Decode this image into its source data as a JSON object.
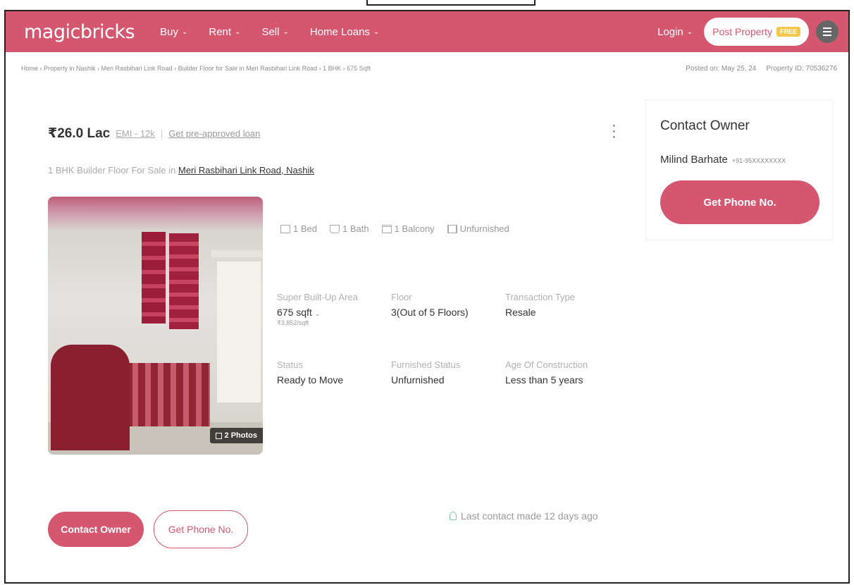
{
  "header": {
    "logo": "magicbricks",
    "nav": [
      {
        "label": "Buy"
      },
      {
        "label": "Rent"
      },
      {
        "label": "Sell"
      },
      {
        "label": "Home Loans"
      }
    ],
    "login": "Login",
    "post_property": "Post Property",
    "free_badge": "FREE",
    "brand_color": "#d4576f"
  },
  "breadcrumb": {
    "path": "Home › Property in Nashik › Meri Rasbihari Link Road › Builder Floor for Sale in Meri Rasbihari Link Road › 1 BHK › 675 Sqft",
    "posted_on": "Posted on: May 25, 24",
    "property_id": "Property ID: 70536276"
  },
  "listing": {
    "price": "26.0 Lac",
    "emi": "EMI - 12k",
    "pre_approved_loan": "Get pre-approved loan",
    "title_prefix": "1 BHK Builder Floor For Sale in",
    "location": "Meri Rasbihari Link Road, Nashik",
    "photos_count": "2 Photos",
    "features": {
      "bed": "1 Bed",
      "bath": "1 Bath",
      "balcony": "1 Balcony",
      "furnishing": "Unfurnished"
    },
    "details": [
      {
        "label": "Super Built-Up Area",
        "value": "675 sqft",
        "sub": "3,852/sqft"
      },
      {
        "label": "Floor",
        "value": "3(Out of 5 Floors)"
      },
      {
        "label": "Transaction Type",
        "value": "Resale"
      },
      {
        "label": "Status",
        "value": "Ready to Move"
      },
      {
        "label": "Furnished Status",
        "value": "Unfurnished"
      },
      {
        "label": "Age Of Construction",
        "value": "Less than 5 years"
      }
    ],
    "contact_owner_btn": "Contact Owner",
    "get_phone_btn": "Get Phone No.",
    "last_contact": "Last contact made 12 days ago"
  },
  "sidebar": {
    "title": "Contact Owner",
    "owner_name": "Milind Barhate",
    "owner_phone": "+91-95XXXXXXXX",
    "get_phone_btn": "Get Phone No."
  }
}
